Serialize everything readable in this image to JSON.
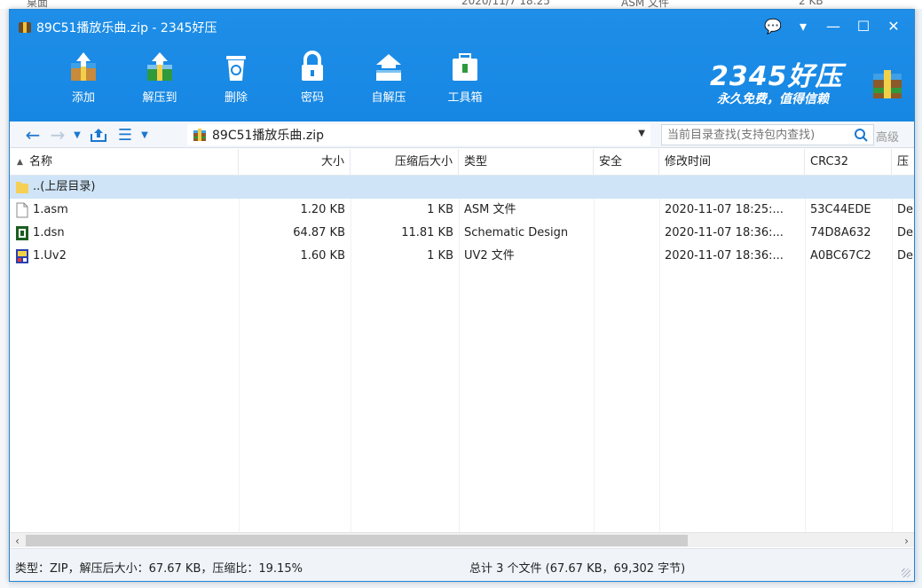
{
  "background": {
    "text_a": "桌面",
    "text_b": "2020/11/7 18:25",
    "text_c": "ASM 文件",
    "text_d": "2 KB"
  },
  "window": {
    "title": "89C51播放乐曲.zip - 2345好压",
    "buttons": [
      "💬",
      "▾",
      "—",
      "☐",
      "✕"
    ]
  },
  "toolbar": {
    "items": [
      {
        "label": "添加",
        "icon": "add-archive-icon"
      },
      {
        "label": "解压到",
        "icon": "extract-to-icon"
      },
      {
        "label": "删除",
        "icon": "recycle-bin-icon"
      },
      {
        "label": "密码",
        "icon": "lock-icon"
      },
      {
        "label": "自解压",
        "icon": "self-extract-icon"
      },
      {
        "label": "工具箱",
        "icon": "toolbox-icon"
      }
    ]
  },
  "brand": {
    "name": "2345好压",
    "slogan": "永久免费，值得信赖"
  },
  "address": {
    "path": "89C51播放乐曲.zip",
    "search_placeholder": "当前目录查找(支持包内查找)",
    "advanced": "高级"
  },
  "columns": [
    "名称",
    "大小",
    "压缩后大小",
    "类型",
    "安全",
    "修改时间",
    "CRC32",
    "压"
  ],
  "parent_row": {
    "name": "..(上层目录)"
  },
  "files": [
    {
      "name": "1.asm",
      "size": "1.20 KB",
      "packed": "1 KB",
      "type": "ASM 文件",
      "security": "",
      "modified": "2020-11-07 18:25:...",
      "crc": "53C44EDE",
      "method": "De"
    },
    {
      "name": "1.dsn",
      "size": "64.87 KB",
      "packed": "11.81 KB",
      "type": "Schematic Design",
      "security": "",
      "modified": "2020-11-07 18:36:...",
      "crc": "74D8A632",
      "method": "De"
    },
    {
      "name": "1.Uv2",
      "size": "1.60 KB",
      "packed": "1 KB",
      "type": "UV2 文件",
      "security": "",
      "modified": "2020-11-07 18:36:...",
      "crc": "A0BC67C2",
      "method": "De"
    }
  ],
  "status": {
    "left": "类型：ZIP，解压后大小：67.67 KB，压缩比：19.15%",
    "right": "总计 3 个文件 (67.67 KB，69,302 字节)"
  },
  "colors": {
    "header_blue": "#1687e3",
    "selection": "#cfe4f7",
    "accent": "#1a78d0"
  }
}
